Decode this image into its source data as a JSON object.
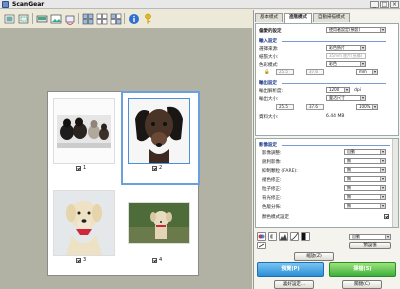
{
  "window": {
    "title": "ScanGear"
  },
  "toolbar": {
    "icons": [
      "preview-icon",
      "crop-icon",
      "scan-icon",
      "thumbnail-icon",
      "grid-view-icon",
      "multi-crop-icon",
      "info-icon",
      "settings-key-icon"
    ]
  },
  "thumbnails": [
    {
      "label": "1",
      "checked": true,
      "selected": false
    },
    {
      "label": "2",
      "checked": true,
      "selected": true
    },
    {
      "label": "3",
      "checked": true,
      "selected": false
    },
    {
      "label": "4",
      "checked": true,
      "selected": false
    }
  ],
  "tabs": [
    "基本模式",
    "進階模式",
    "自動掃描模式"
  ],
  "favorite": {
    "label": "偏愛的設定",
    "value": "使用者設定(預設)"
  },
  "input": {
    "section": "輸入設定",
    "source_label": "選擇來源:",
    "source_value": "彩色負片",
    "paper_label": "紙張大小:",
    "paper_value": "35mm 底片(長條)",
    "mode_label": "色彩模式:",
    "mode_value": "彩色",
    "w_value": "25.5",
    "h_value": "37.6",
    "unit_value": "mm"
  },
  "output": {
    "section": "輸出設定",
    "res_label": "輸出解析度:",
    "res_value": "1200",
    "dpi_value": "dpi",
    "size_label": "輸出大小:",
    "size_value": "靈活尺寸",
    "w_value": "25.5",
    "h_value": "37.6",
    "pct_value": "100%",
    "data_label": "資料大小:",
    "data_value": "6.44 MB"
  },
  "image": {
    "section": "影像設定",
    "items": [
      {
        "label": "影像調整:",
        "value": "自動"
      },
      {
        "label": "銳利影像:",
        "value": "無"
      },
      {
        "label": "抑制顆粒 (FARE):",
        "value": "無"
      },
      {
        "label": "褪色修正:",
        "value": "無"
      },
      {
        "label": "粒子修正:",
        "value": "無"
      },
      {
        "label": "背光修正:",
        "value": "無"
      },
      {
        "label": "色版分佈:",
        "value": "無"
      }
    ],
    "preset_label": "顏色模式設定",
    "preset_value": "自動"
  },
  "buttons": {
    "reset_small": "預設值",
    "zoom": "縮放(Z)",
    "preview": "預覽(P)",
    "scan": "掃描(S)",
    "prefs": "喜好設定...",
    "close": "關閉(C)"
  },
  "colors": {
    "preview_bg": "#b2b2a4",
    "preview_button": "#3aa0e0",
    "scan_button": "#4cc34a"
  }
}
